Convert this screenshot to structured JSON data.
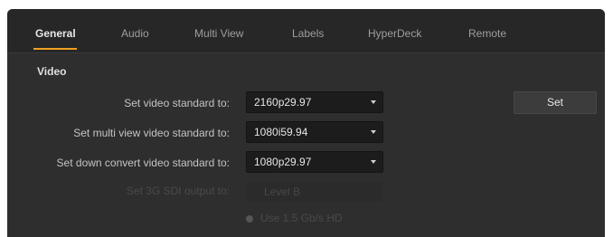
{
  "tabs": [
    {
      "label": "General",
      "active": true
    },
    {
      "label": "Audio",
      "active": false
    },
    {
      "label": "Multi View",
      "active": false
    },
    {
      "label": "Labels",
      "active": false
    },
    {
      "label": "HyperDeck",
      "active": false
    },
    {
      "label": "Remote",
      "active": false
    }
  ],
  "video": {
    "section_title": "Video",
    "rows": [
      {
        "label": "Set video standard to:",
        "value": "2160p29.97"
      },
      {
        "label": "Set multi view video standard to:",
        "value": "1080i59.94"
      },
      {
        "label": "Set down convert video standard to:",
        "value": "1080p29.97"
      }
    ],
    "set_button_label": "Set",
    "disabled_row": {
      "label": "Set 3G SDI output to:",
      "value": "Level B"
    },
    "disabled_option": "Use 1.5 Gb/s HD"
  },
  "colors": {
    "accent": "#f0a020",
    "panel_bg": "#2e2e2e",
    "tabbar_bg": "#272727",
    "dropdown_bg": "#1c1c1c"
  }
}
